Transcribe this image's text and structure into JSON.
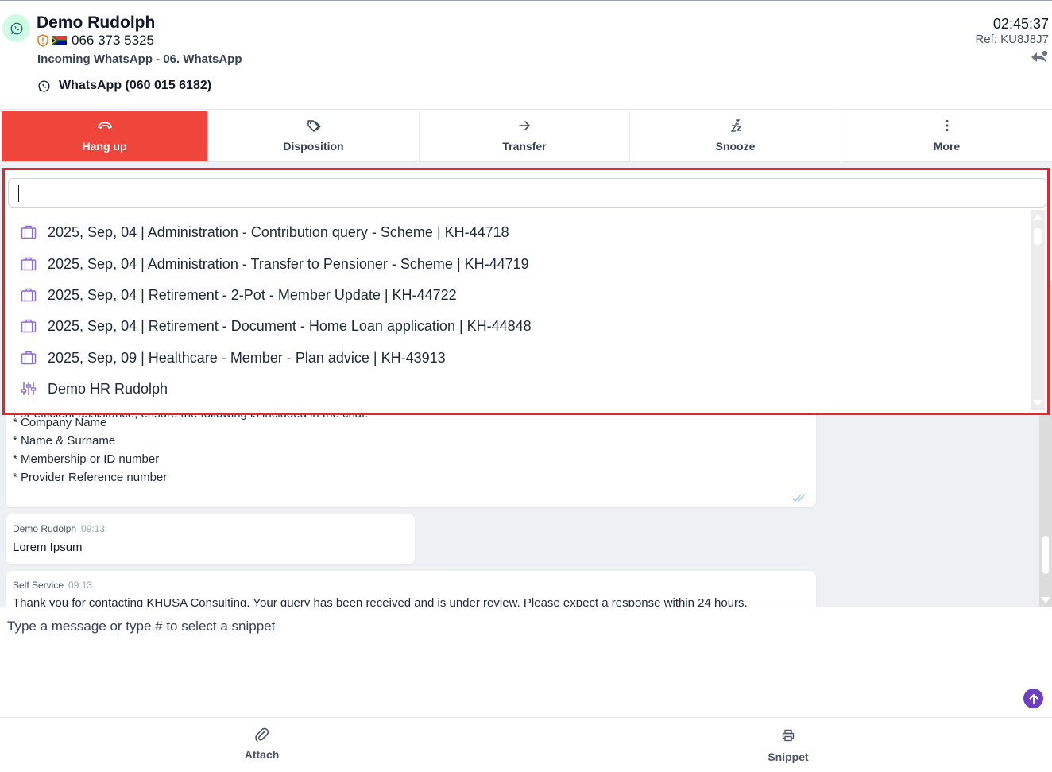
{
  "header": {
    "contact_name": "Demo Rudolph",
    "phone": "066 373 5325",
    "channel": "Incoming WhatsApp - 06. WhatsApp",
    "whatsapp_line": "WhatsApp (060 015 6182)",
    "timer": "02:45:37",
    "reference": "Ref: KU8J8J7"
  },
  "toolbar": {
    "hangup": "Hang up",
    "disposition": "Disposition",
    "transfer": "Transfer",
    "snooze": "Snooze",
    "more": "More"
  },
  "dropdown": {
    "search_value": "",
    "items": [
      {
        "icon": "briefcase-icon",
        "label": "2025, Sep, 04 | Administration - Contribution query - Scheme | KH-44718"
      },
      {
        "icon": "briefcase-icon",
        "label": "2025, Sep, 04 | Administration - Transfer to Pensioner - Scheme | KH-44719"
      },
      {
        "icon": "briefcase-icon",
        "label": "2025, Sep, 04 | Retirement - 2-Pot - Member Update | KH-44722"
      },
      {
        "icon": "briefcase-icon",
        "label": "2025, Sep, 04 | Retirement - Document - Home Loan application | KH-44848"
      },
      {
        "icon": "briefcase-icon",
        "label": "2025, Sep, 09 | Healthcare - Member - Plan advice | KH-43913"
      },
      {
        "icon": "sliders-icon",
        "label": "Demo HR Rudolph"
      }
    ]
  },
  "messages": {
    "first": {
      "partial_line": "For efficient assistance, ensure the following is included in the chat:",
      "lines": [
        "* Company Name",
        "* Name & Surname",
        "* Membership or ID number",
        "* Provider Reference number"
      ]
    },
    "second": {
      "sender": "Demo Rudolph",
      "time": "09:13",
      "text": "Lorem Ipsum"
    },
    "third": {
      "sender": "Self Service",
      "time": "09:13",
      "text": "Thank you for contacting KHUSA Consulting. Your query has been received and is under review. Please expect a response within 24 hours."
    }
  },
  "composer": {
    "placeholder": "Type a message or type # to select a snippet"
  },
  "bottombar": {
    "attach": "Attach",
    "snippet": "Snippet"
  },
  "colors": {
    "hangup": "#f0453b",
    "highlight": "#e3262e",
    "accent": "#6d3fc4",
    "icon_purple": "#8b6ccf",
    "whatsapp": "#10b981"
  }
}
